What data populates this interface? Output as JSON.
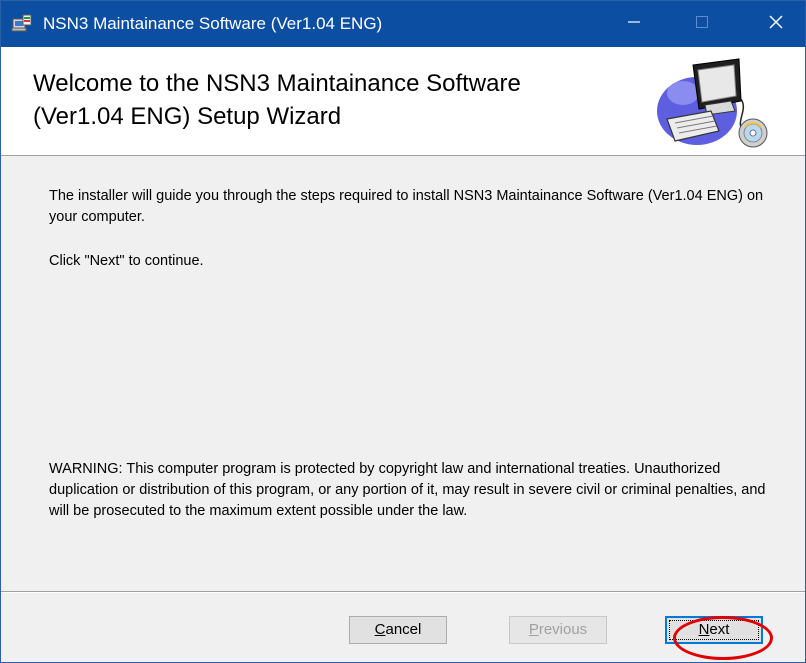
{
  "window": {
    "title": "NSN3 Maintainance Software (Ver1.04 ENG)",
    "controls": {
      "minimize": "minimize-icon",
      "maximize": "maximize-icon",
      "close": "close-icon"
    },
    "icon": "installer-icon"
  },
  "header": {
    "title": "Welcome to the NSN3 Maintainance Software (Ver1.04 ENG) Setup Wizard",
    "banner_icon": "computer-setup-icon"
  },
  "body": {
    "intro": "The installer will guide you through the steps required to install NSN3 Maintainance Software (Ver1.04 ENG) on your computer.",
    "instruction": "Click \"Next\" to continue.",
    "warning": "WARNING: This computer program is protected by copyright law and international treaties. Unauthorized duplication or distribution of this program, or any portion of it, may result in severe civil or criminal penalties, and will be prosecuted to the maximum extent possible under the law."
  },
  "buttons": {
    "cancel": {
      "accel": "C",
      "rest": "ancel",
      "enabled": true
    },
    "previous": {
      "accel": "P",
      "rest": "revious",
      "enabled": false
    },
    "next": {
      "accel": "N",
      "rest": "ext",
      "enabled": true,
      "focused": true
    }
  },
  "annotation": {
    "color": "#e00000",
    "target": "next"
  },
  "colors": {
    "titlebar": "#0b4ea2",
    "header_bg": "#ffffff",
    "window_bg": "#f0f0f0",
    "focus_border": "#0078d7"
  }
}
